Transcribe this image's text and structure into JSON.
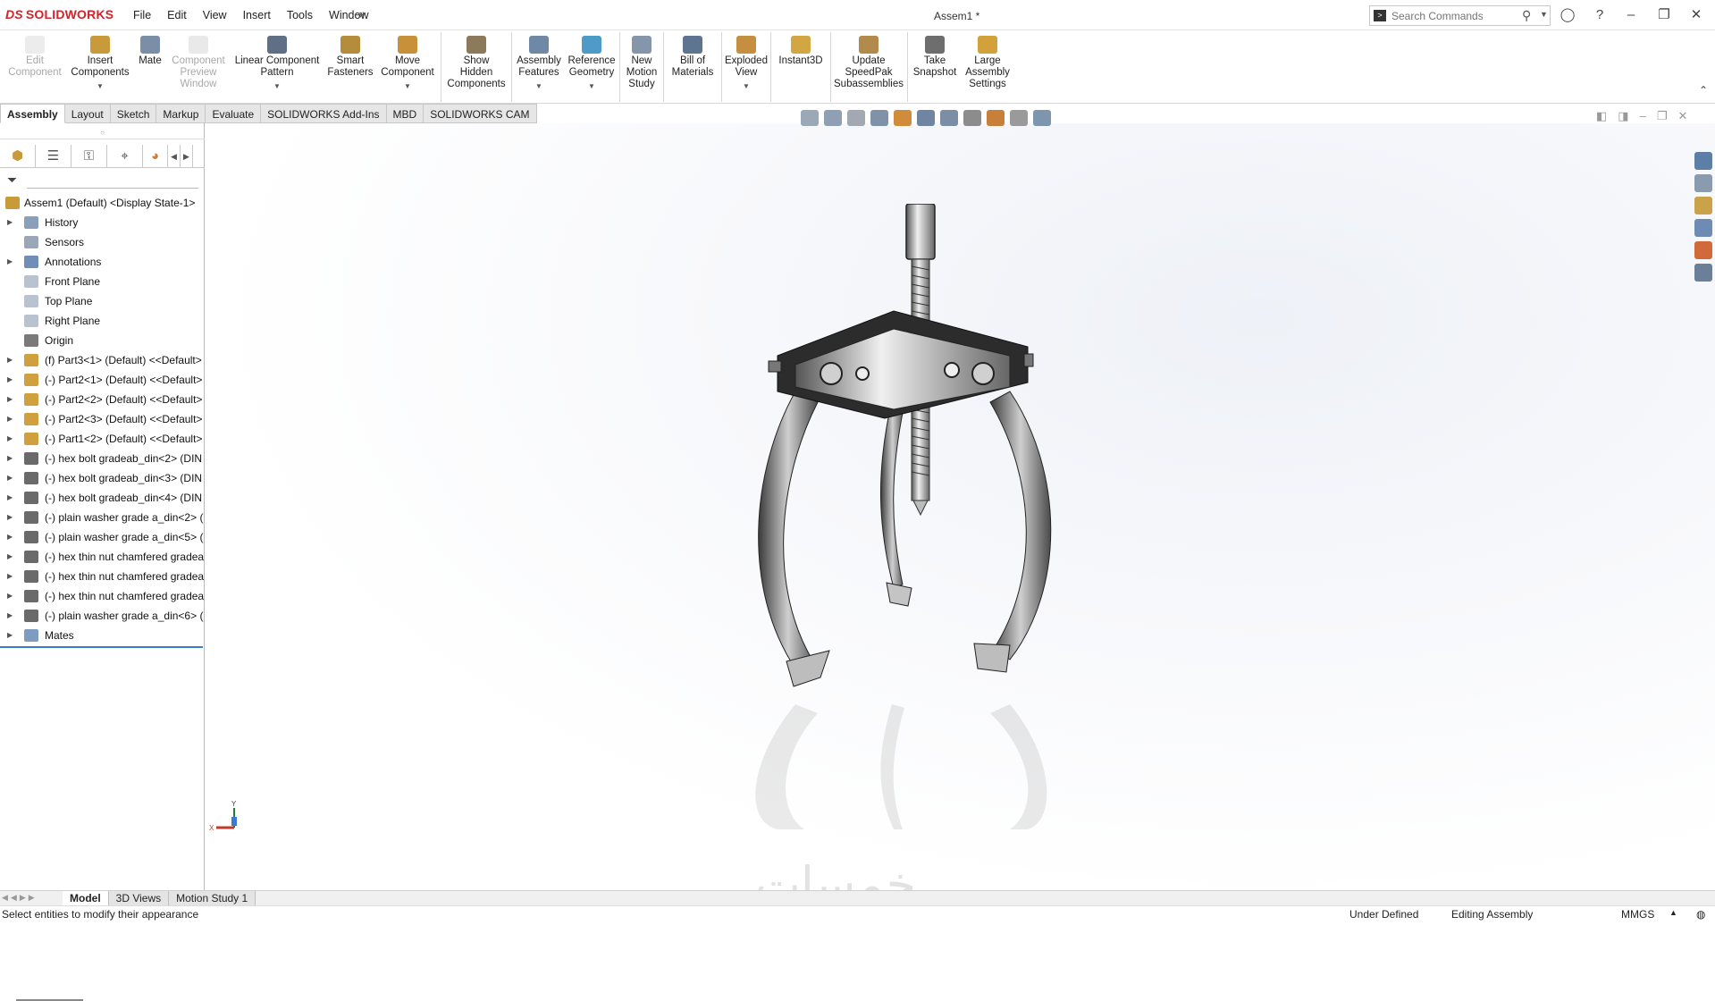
{
  "app": {
    "logo_ds": "DS",
    "logo_name": "SOLIDWORKS",
    "doc_title": "Assem1 *"
  },
  "menu": [
    "File",
    "Edit",
    "View",
    "Insert",
    "Tools",
    "Window"
  ],
  "search": {
    "placeholder": "Search Commands"
  },
  "commands": [
    {
      "label1": "Edit",
      "label2": "Component",
      "label3": "",
      "enabled": false,
      "icon": "edit-component-icon"
    },
    {
      "label1": "Insert",
      "label2": "Components",
      "label3": "",
      "enabled": true,
      "icon": "insert-components-icon"
    },
    {
      "label1": "Mate",
      "label2": "",
      "label3": "",
      "enabled": true,
      "icon": "mate-icon"
    },
    {
      "label1": "Component",
      "label2": "Preview",
      "label3": "Window",
      "enabled": false,
      "icon": "component-preview-icon"
    },
    {
      "label1": "Linear Component",
      "label2": "Pattern",
      "label3": "",
      "enabled": true,
      "icon": "linear-pattern-icon"
    },
    {
      "label1": "Smart",
      "label2": "Fasteners",
      "label3": "",
      "enabled": true,
      "icon": "smart-fasteners-icon"
    },
    {
      "label1": "Move",
      "label2": "Component",
      "label3": "",
      "enabled": true,
      "icon": "move-component-icon"
    },
    {
      "label1": "Show",
      "label2": "Hidden",
      "label3": "Components",
      "enabled": true,
      "icon": "show-hidden-icon"
    },
    {
      "label1": "Assembly",
      "label2": "Features",
      "label3": "",
      "enabled": true,
      "icon": "assembly-features-icon"
    },
    {
      "label1": "Reference",
      "label2": "Geometry",
      "label3": "",
      "enabled": true,
      "icon": "reference-geometry-icon"
    },
    {
      "label1": "New",
      "label2": "Motion",
      "label3": "Study",
      "enabled": true,
      "icon": "motion-study-icon"
    },
    {
      "label1": "Bill of",
      "label2": "Materials",
      "label3": "",
      "enabled": true,
      "icon": "bom-icon"
    },
    {
      "label1": "Exploded",
      "label2": "View",
      "label3": "",
      "enabled": true,
      "icon": "exploded-view-icon"
    },
    {
      "label1": "Instant3D",
      "label2": "",
      "label3": "",
      "enabled": true,
      "icon": "instant3d-icon"
    },
    {
      "label1": "Update",
      "label2": "SpeedPak",
      "label3": "Subassemblies",
      "enabled": true,
      "icon": "speedpak-icon"
    },
    {
      "label1": "Take",
      "label2": "Snapshot",
      "label3": "",
      "enabled": true,
      "icon": "snapshot-icon"
    },
    {
      "label1": "Large",
      "label2": "Assembly",
      "label3": "Settings",
      "enabled": true,
      "icon": "large-assembly-icon"
    }
  ],
  "tabs": [
    "Assembly",
    "Layout",
    "Sketch",
    "Markup",
    "Evaluate",
    "SOLIDWORKS Add-Ins",
    "MBD",
    "SOLIDWORKS CAM"
  ],
  "active_tab": "Assembly",
  "tree": {
    "root": "Assem1 (Default) <Display State-1>",
    "items": [
      {
        "label": "History",
        "expandable": true,
        "icon": "history-icon"
      },
      {
        "label": "Sensors",
        "expandable": false,
        "icon": "sensors-icon"
      },
      {
        "label": "Annotations",
        "expandable": true,
        "icon": "annotations-icon"
      },
      {
        "label": "Front Plane",
        "expandable": false,
        "icon": "plane-icon"
      },
      {
        "label": "Top Plane",
        "expandable": false,
        "icon": "plane-icon"
      },
      {
        "label": "Right Plane",
        "expandable": false,
        "icon": "plane-icon"
      },
      {
        "label": "Origin",
        "expandable": false,
        "icon": "origin-icon"
      },
      {
        "label": "(f) Part3<1> (Default) <<Default>",
        "expandable": true,
        "icon": "part-icon"
      },
      {
        "label": "(-) Part2<1> (Default) <<Default>",
        "expandable": true,
        "icon": "part-icon"
      },
      {
        "label": "(-) Part2<2> (Default) <<Default>",
        "expandable": true,
        "icon": "part-icon"
      },
      {
        "label": "(-) Part2<3> (Default) <<Default>",
        "expandable": true,
        "icon": "part-icon"
      },
      {
        "label": "(-) Part1<2> (Default) <<Default>",
        "expandable": true,
        "icon": "part-icon"
      },
      {
        "label": "(-) hex bolt gradeab_din<2> (DIN",
        "expandable": true,
        "icon": "toolbox-icon"
      },
      {
        "label": "(-) hex bolt gradeab_din<3> (DIN",
        "expandable": true,
        "icon": "toolbox-icon"
      },
      {
        "label": "(-) hex bolt gradeab_din<4> (DIN",
        "expandable": true,
        "icon": "toolbox-icon"
      },
      {
        "label": "(-) plain washer grade a_din<2> (",
        "expandable": true,
        "icon": "toolbox-icon"
      },
      {
        "label": "(-) plain washer grade a_din<5> (",
        "expandable": true,
        "icon": "toolbox-icon"
      },
      {
        "label": "(-) hex thin nut chamfered gradea",
        "expandable": true,
        "icon": "toolbox-icon"
      },
      {
        "label": "(-) hex thin nut chamfered gradea",
        "expandable": true,
        "icon": "toolbox-icon"
      },
      {
        "label": "(-) hex thin nut chamfered gradea",
        "expandable": true,
        "icon": "toolbox-icon"
      },
      {
        "label": "(-) plain washer grade a_din<6> (",
        "expandable": true,
        "icon": "toolbox-icon"
      },
      {
        "label": "Mates",
        "expandable": true,
        "icon": "mates-icon"
      }
    ]
  },
  "triad": {
    "y": "Y",
    "x": "X"
  },
  "watermark": "خمسات",
  "bottom_tabs": [
    "Model",
    "3D Views",
    "Motion Study 1"
  ],
  "active_bottom_tab": "Model",
  "status": {
    "message": "Select entities to modify their appearance",
    "state": "Under Defined",
    "mode": "Editing Assembly",
    "units": "MMGS"
  },
  "colors": {
    "brand": "#d2232a",
    "selection": "#3a80c8"
  }
}
